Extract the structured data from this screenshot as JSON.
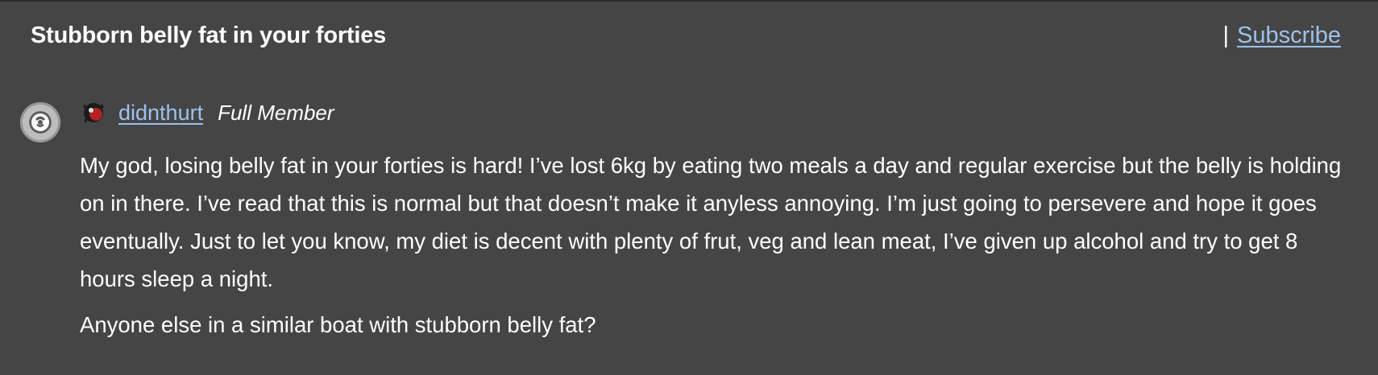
{
  "header": {
    "title": "Stubborn belly fat in your forties",
    "separator": "|",
    "subscribe_label": "Subscribe"
  },
  "post": {
    "author": "didnthurt",
    "rank": "Full Member",
    "icons": {
      "avatar": "user-avatar-icon",
      "badge": "member-badge-icon"
    },
    "paragraphs": [
      "My god, losing belly fat in your forties is hard! I’ve lost 6kg by eating two meals a day and regular exercise but the belly is holding on in there. I’ve read that this is normal but that doesn’t make it anyless annoying. I’m just going to persevere and hope it goes eventually. Just to let you know, my diet is decent with plenty of frut, veg and lean meat, I’ve given up alcohol and try to get 8 hours sleep a night.",
      "Anyone else in a similar boat with stubborn belly fat?"
    ]
  },
  "colors": {
    "background": "#454545",
    "link": "#9cc2ec",
    "text": "#ffffff"
  }
}
